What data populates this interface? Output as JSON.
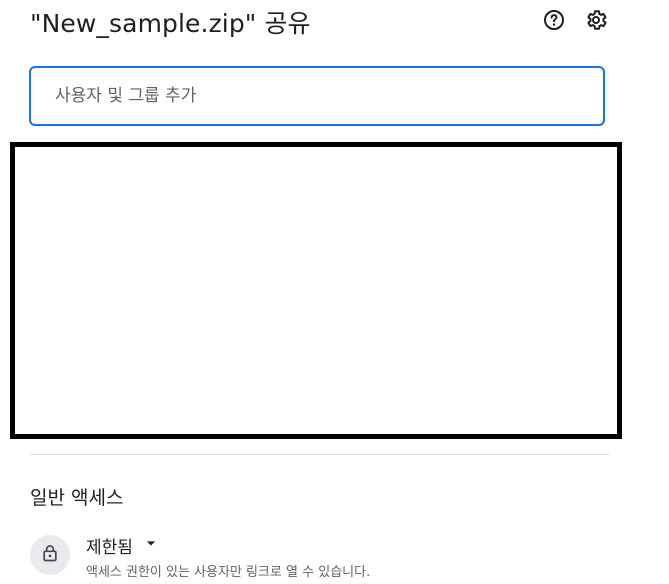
{
  "dialog": {
    "title": "\"New_sample.zip\" 공유",
    "help_icon": "help-icon",
    "settings_icon": "gear-icon"
  },
  "share_input": {
    "placeholder": "사용자 및 그룹 추가",
    "value": ""
  },
  "general_access": {
    "section_title": "일반 액세스",
    "icon": "lock-icon",
    "selected": "제한됨",
    "description": "액세스 권한이 있는 사용자만 링크로 열 수 있습니다."
  },
  "colors": {
    "accent": "#1a73e8",
    "text": "#202124",
    "secondary_text": "#5f6368",
    "divider": "#dadce0"
  }
}
